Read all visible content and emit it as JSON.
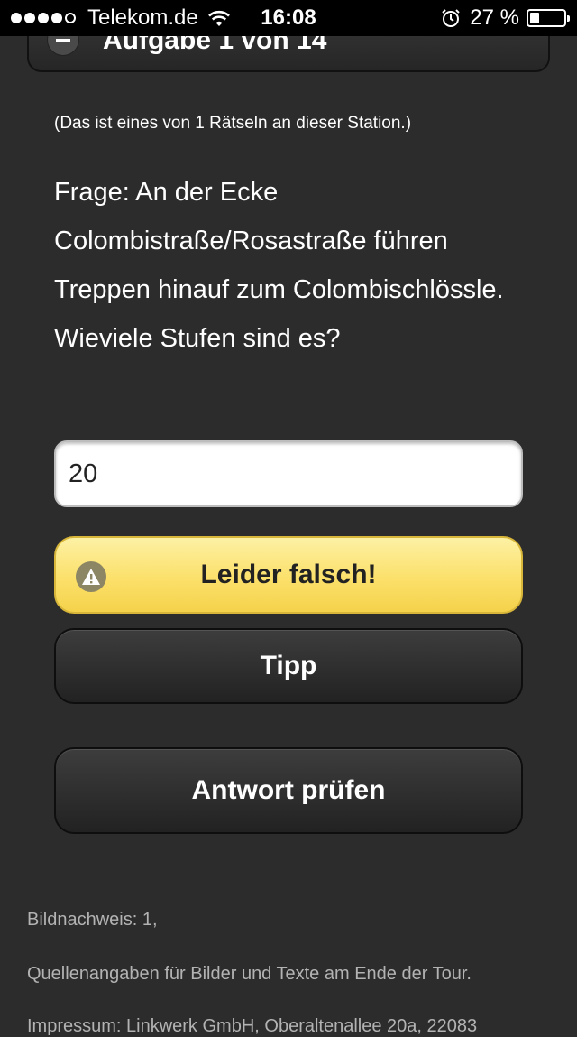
{
  "status_bar": {
    "carrier": "Telekom.de",
    "time": "16:08",
    "battery": "27 %",
    "battery_level": 0.27,
    "signal_bars": 4,
    "signal_max": 5
  },
  "header": {
    "title": "Aufgabe 1 von 14"
  },
  "content": {
    "station_note": "(Das ist eines von 1 Rätseln an dieser Station.)",
    "question": "Frage: An der Ecke Colombistraße/Rosastraße führen Treppen hinauf zum Colombischlössle. Wieviele Stufen sind es?",
    "answer_value": "20"
  },
  "buttons": {
    "result_label": "Leider falsch!",
    "tip_label": "Tipp",
    "check_label": "Antwort prüfen"
  },
  "footer": {
    "image_credits": "Bildnachweis: 1,",
    "sources": "Quellenangaben für Bilder und Texte am Ende der Tour.",
    "imprint": "Impressum: Linkwerk GmbH, Oberaltenallee 20a, 22083"
  },
  "colors": {
    "background": "#2c2c2c",
    "warning": "#fbe06a",
    "button_dark": "#2e2e2e"
  }
}
